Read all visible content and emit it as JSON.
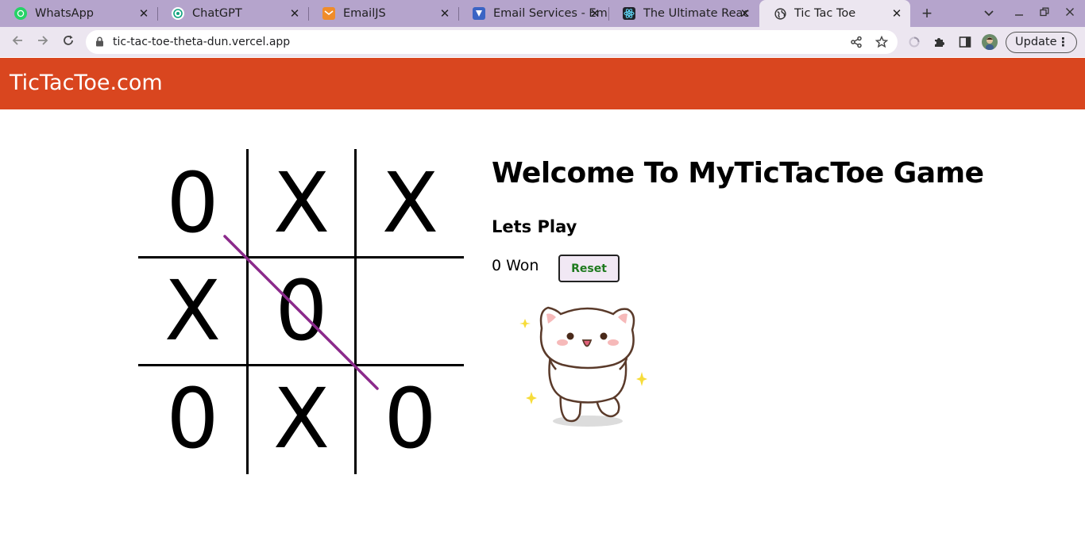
{
  "browser": {
    "tabs": [
      {
        "title": "WhatsApp",
        "icon": "whatsapp-icon"
      },
      {
        "title": "ChatGPT",
        "icon": "chatgpt-icon"
      },
      {
        "title": "EmailJS",
        "icon": "emailjs-icon"
      },
      {
        "title": "Email Services - Em",
        "icon": "email-services-icon"
      },
      {
        "title": "The Ultimate Reac",
        "icon": "react-icon"
      },
      {
        "title": "Tic Tac Toe",
        "icon": "globe-icon",
        "active": true
      }
    ],
    "url": "tic-tac-toe-theta-dun.vercel.app",
    "update_label": "Update"
  },
  "site": {
    "brand": "TicTacToe.com",
    "header_color": "#d9461f"
  },
  "board": {
    "cells": [
      "0",
      "X",
      "X",
      "X",
      "0",
      "",
      "0",
      "X",
      "0"
    ],
    "winning_line": {
      "from_cell": 0,
      "to_cell": 8,
      "color": "#8b2a8b"
    }
  },
  "panel": {
    "welcome": "Welcome To MyTicTacToe Game",
    "subtitle": "Lets Play",
    "status": "0 Won",
    "reset_label": "Reset",
    "reset_text_color": "#1e7a1e"
  },
  "mascot": {
    "icon": "cheering-cat-sticker"
  }
}
